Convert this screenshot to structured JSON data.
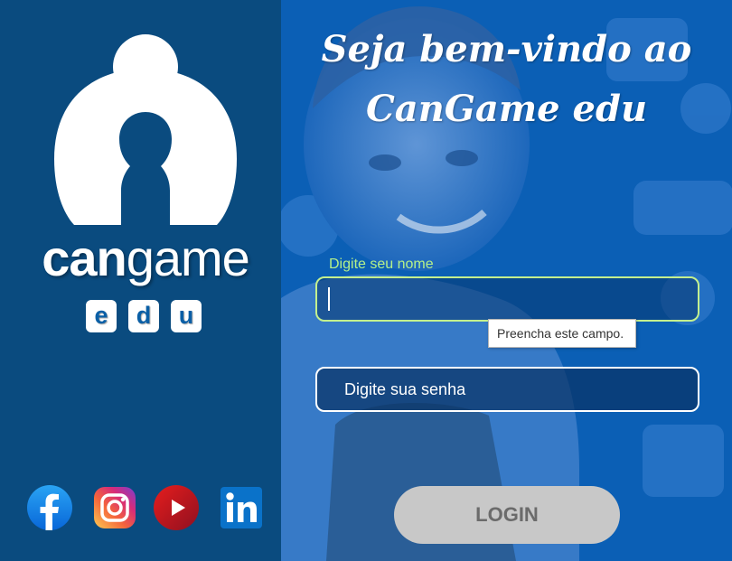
{
  "brand": {
    "logo_icon": "cangame-person-arch-logo",
    "word_bold": "can",
    "word_light": "game",
    "edu_letters": [
      "e",
      "d",
      "u"
    ]
  },
  "social": [
    {
      "name": "facebook-icon",
      "color": "#1877f2"
    },
    {
      "name": "instagram-icon",
      "color": "#e1306c"
    },
    {
      "name": "youtube-icon",
      "color": "#d01a1a"
    },
    {
      "name": "linkedin-icon",
      "color": "#0a66c2"
    }
  ],
  "welcome": {
    "line1": "Seja bem-vindo ao",
    "line2": "CanGame edu"
  },
  "form": {
    "name_label": "Digite seu nome",
    "name_value": "",
    "validation_tooltip": "Preencha este campo.",
    "password_placeholder": "Digite sua senha",
    "login_label": "LOGIN"
  },
  "colors": {
    "left_panel": "#0a4b7f",
    "right_panel": "#0a62b8",
    "focus_border": "#c3f08e",
    "login_button": "#c8c8c8"
  }
}
